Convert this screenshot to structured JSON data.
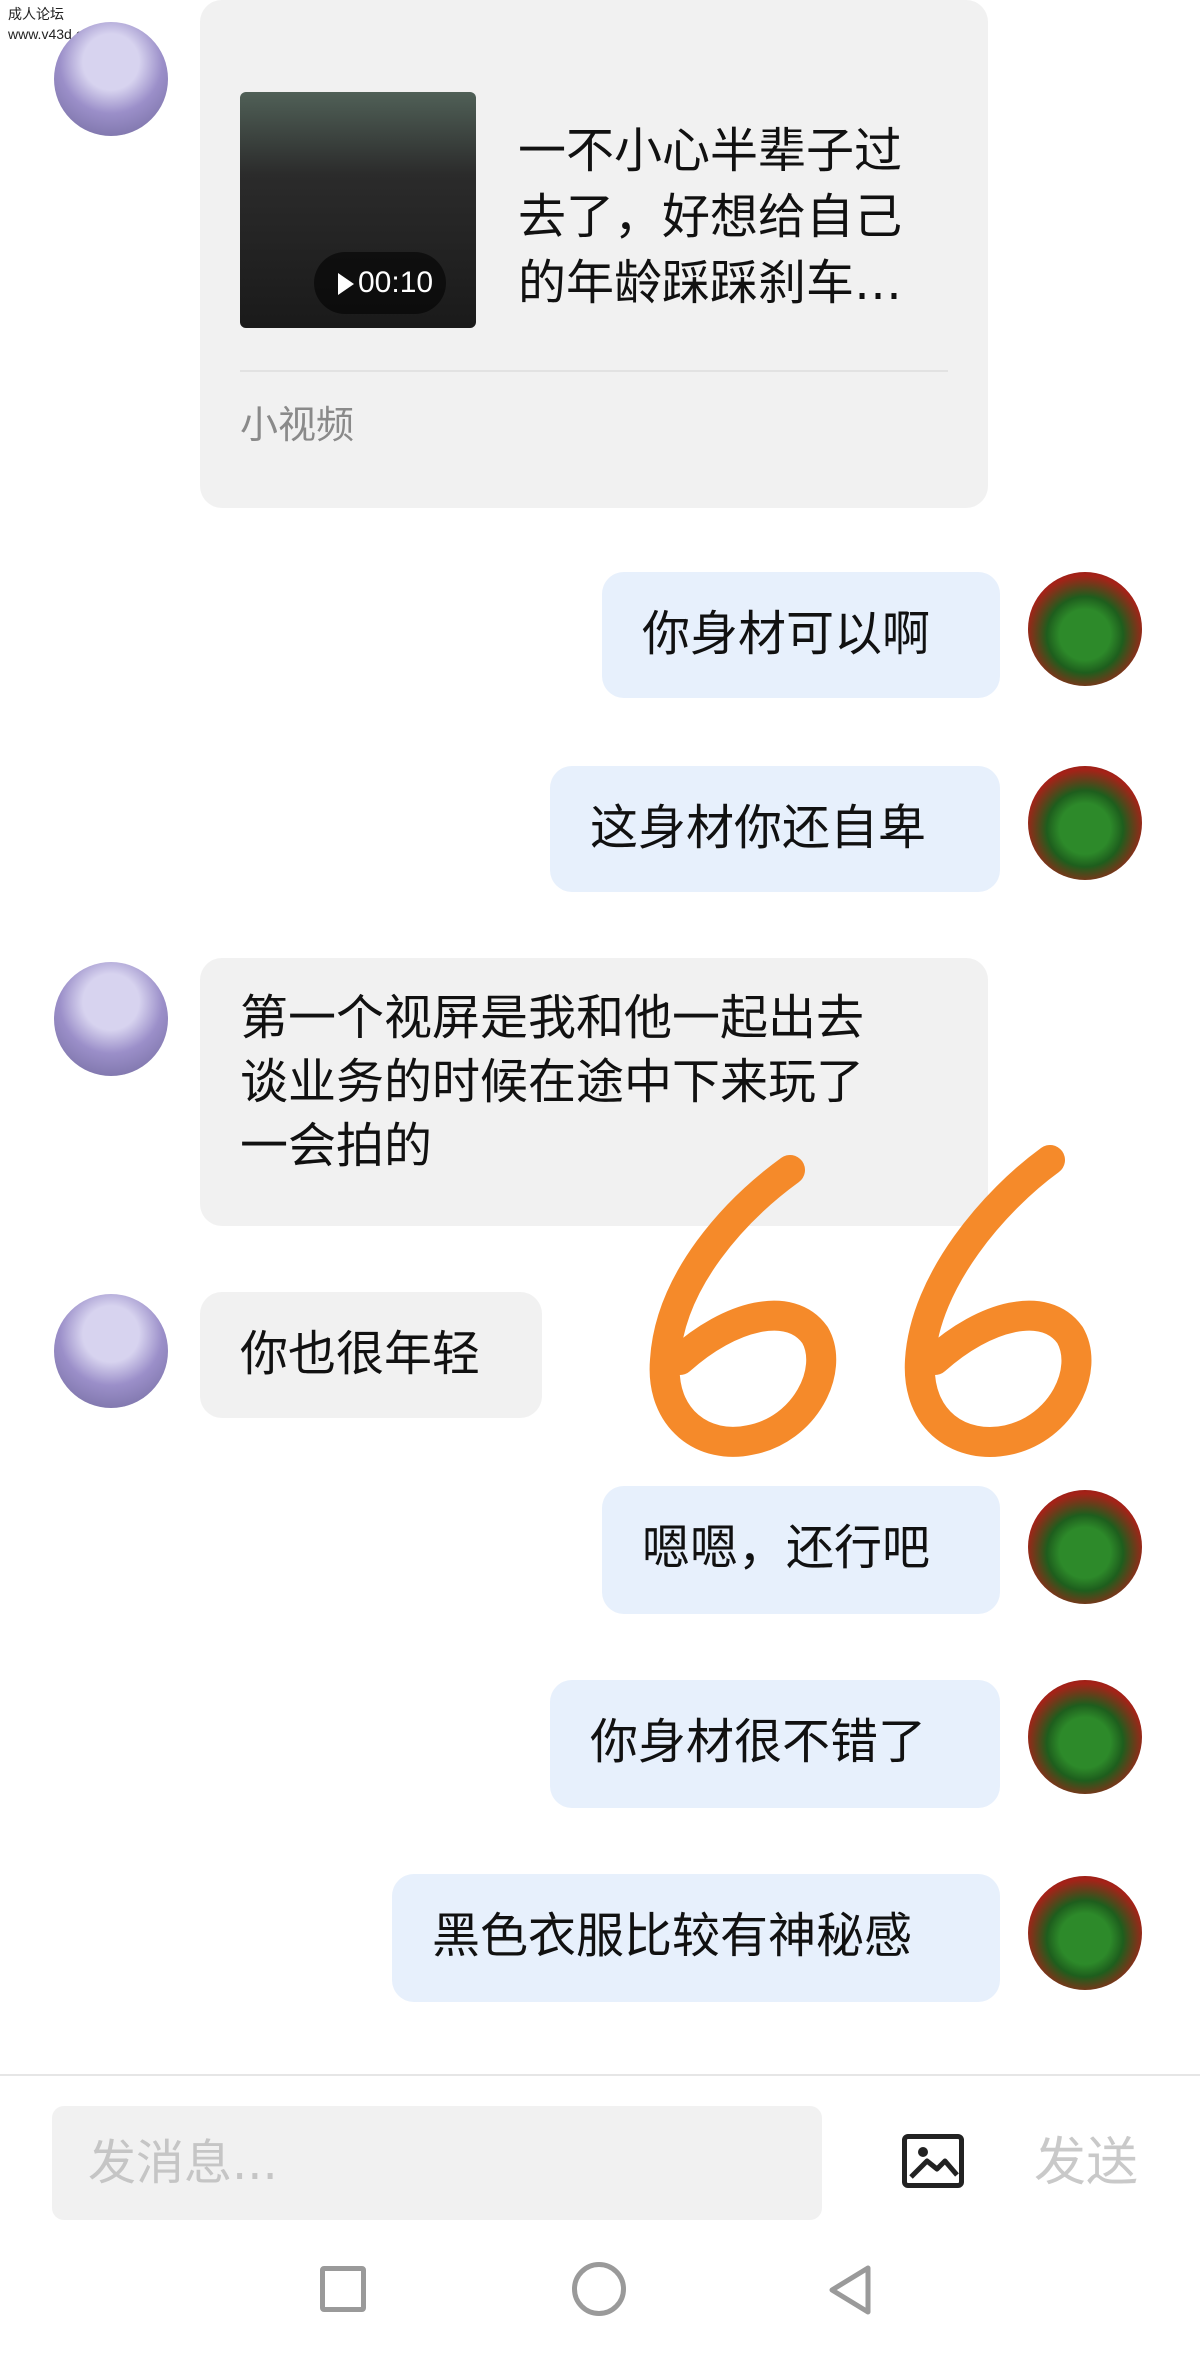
{
  "watermark": {
    "line1": "成人论坛",
    "line2": "www.v43d.com"
  },
  "video_card": {
    "duration": "00:10",
    "title": "一不小心半辈子过\n去了，好想给自己\n的年龄踩踩刹车…",
    "label": "小视频"
  },
  "messages": [
    {
      "side": "right",
      "text": "你身材可以啊"
    },
    {
      "side": "right",
      "text": "这身材你还自卑"
    },
    {
      "side": "left",
      "text": "第一个视屏是我和他一起出去\n谈业务的时候在途中下来玩了\n一会拍的"
    },
    {
      "side": "left",
      "text": "你也很年轻"
    },
    {
      "side": "right",
      "text": "嗯嗯，还行吧"
    },
    {
      "side": "right",
      "text": "你身材很不错了"
    },
    {
      "side": "right",
      "text": "黑色衣服比较有神秘感"
    }
  ],
  "overlay": {
    "handwritten": "66",
    "color": "#f58a2a"
  },
  "input": {
    "placeholder": "发消息..."
  },
  "send_label": "发送",
  "colors": {
    "left_bubble": "#f1f1f1",
    "right_bubble": "#e7f0fc"
  }
}
